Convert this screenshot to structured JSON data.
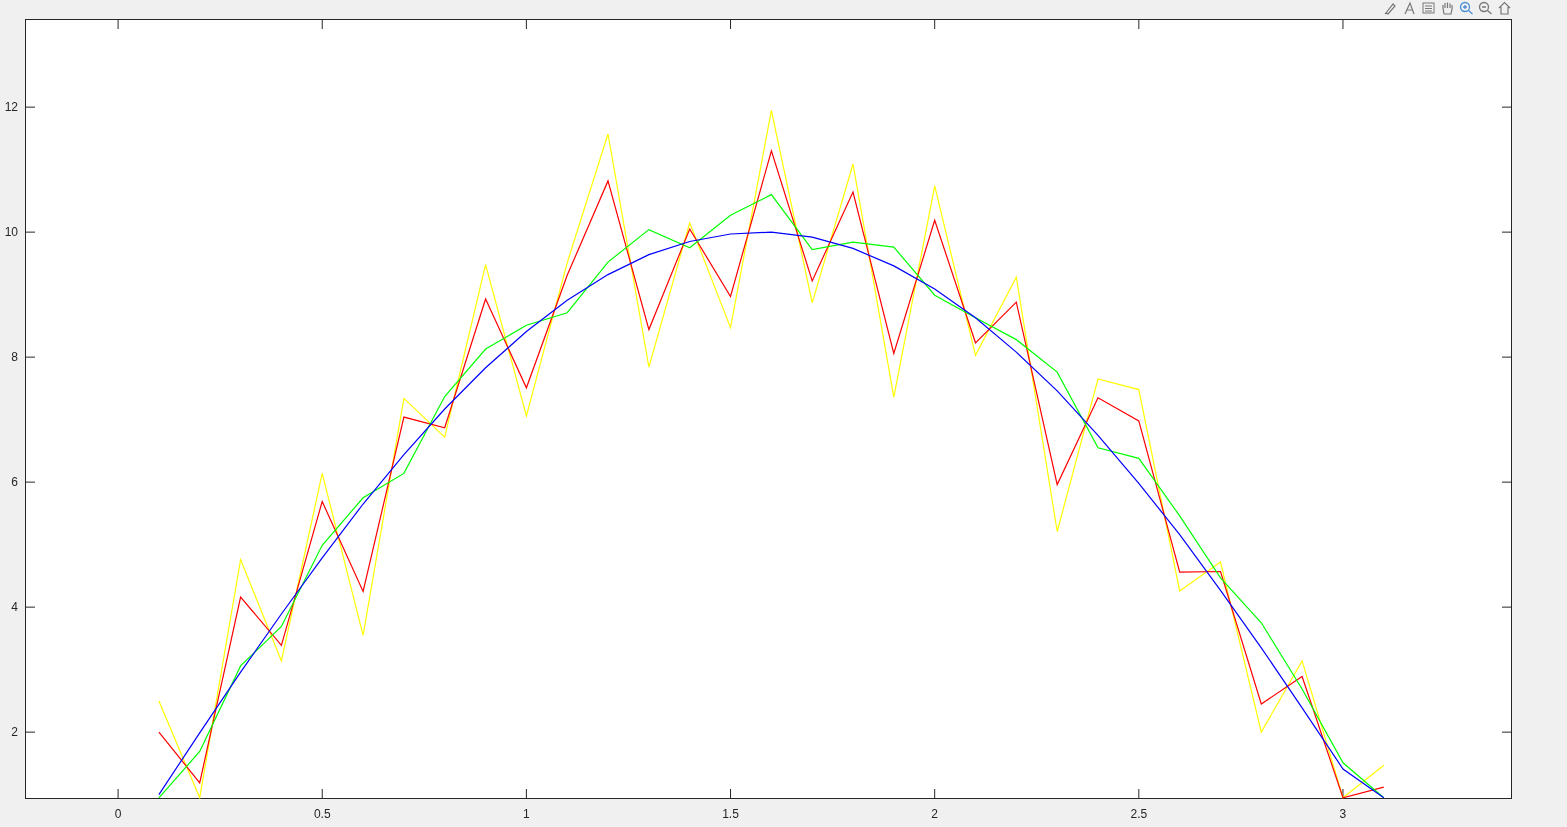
{
  "figure": {
    "chart_data": {
      "type": "line",
      "xlim": [
        -0.228,
        3.414
      ],
      "ylim": [
        0.93,
        13.41
      ],
      "xticks": [
        0,
        {
          "value": 0.5,
          "label": "0.5"
        },
        1,
        {
          "value": 1.5,
          "label": "1.5"
        },
        2,
        {
          "value": 2.5,
          "label": "2.5"
        },
        3
      ],
      "yticks": [
        2,
        4,
        6,
        8,
        10,
        12
      ],
      "x": [
        0.1,
        0.2,
        0.3,
        0.4,
        0.5,
        0.6,
        0.7,
        0.8,
        0.9,
        1.0,
        1.1,
        1.2,
        1.3,
        1.4,
        1.5,
        1.6,
        1.7,
        1.8,
        1.9,
        2.0,
        2.1,
        2.2,
        2.3,
        2.4,
        2.5,
        2.6,
        2.7,
        2.8,
        2.9,
        3.0,
        3.1
      ],
      "series": [
        {
          "color": "#ffff00",
          "values": [
            2.5,
            0.95,
            4.76,
            3.14,
            6.14,
            3.55,
            7.34,
            6.72,
            9.48,
            7.06,
            9.51,
            11.57,
            7.84,
            10.15,
            8.47,
            11.95,
            8.87,
            11.09,
            7.36,
            10.74,
            8.03,
            9.28,
            5.21,
            7.65,
            7.48,
            4.26,
            4.72,
            2.0,
            3.14,
            0.95,
            1.47
          ]
        },
        {
          "color": "#ff0000",
          "values": [
            2.0,
            1.19,
            4.16,
            3.39,
            5.69,
            4.25,
            7.04,
            6.87,
            8.93,
            7.51,
            9.31,
            10.82,
            8.44,
            10.05,
            8.97,
            11.3,
            9.22,
            10.64,
            8.06,
            10.19,
            8.23,
            8.88,
            5.96,
            7.35,
            6.98,
            4.56,
            4.57,
            2.45,
            2.89,
            0.95,
            1.12
          ]
        },
        {
          "color": "#00ff00",
          "values": [
            0.95,
            1.69,
            3.06,
            3.69,
            4.99,
            5.75,
            6.14,
            7.37,
            8.13,
            8.51,
            8.71,
            9.52,
            10.04,
            9.75,
            10.27,
            10.6,
            9.72,
            9.84,
            9.76,
            8.99,
            8.63,
            8.28,
            7.76,
            6.55,
            6.38,
            5.46,
            4.47,
            3.75,
            2.69,
            1.51,
            0.95
          ]
        },
        {
          "color": "#0000ff",
          "values": [
            1.0,
            1.99,
            2.96,
            3.89,
            4.79,
            5.65,
            6.44,
            7.17,
            7.83,
            8.41,
            8.91,
            9.32,
            9.64,
            9.85,
            9.97,
            10.0,
            9.92,
            9.74,
            9.46,
            9.09,
            8.63,
            8.08,
            7.46,
            6.75,
            5.98,
            5.16,
            4.27,
            3.35,
            2.39,
            1.41,
            0.95
          ]
        }
      ]
    }
  }
}
